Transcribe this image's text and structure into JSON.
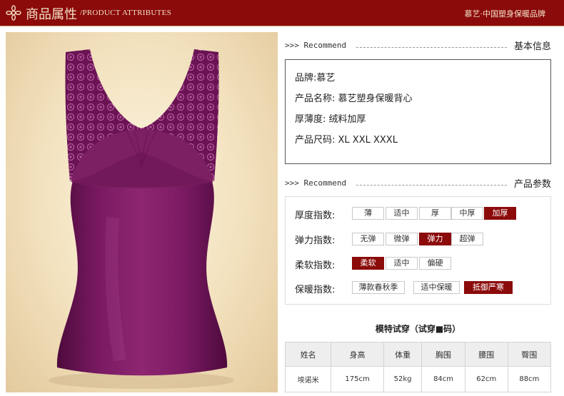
{
  "header": {
    "title_cn": "商品属性",
    "title_en": "/PRODUCT ATTRIBUTES",
    "brand": "慕艺·中国塑身保暖品牌",
    "bg_color": "#8b0a0a"
  },
  "product_image": {
    "alt": "紫色蕾丝保暖背心",
    "color": "#7d1f63"
  },
  "basic_info": {
    "recommend": ">>> Recommend",
    "title": "基本信息",
    "rows": [
      "品牌:慕艺",
      "产品名称: 慕艺塑身保暖背心",
      "厚薄度: 绒料加厚",
      "产品尺码: XL XXL XXXL"
    ]
  },
  "params": {
    "recommend": ">>> Recommend",
    "title": "产品参数",
    "rows": [
      {
        "label": "厚度指数:",
        "options": [
          "薄",
          "适中",
          "厚",
          "中厚",
          "加厚"
        ],
        "selected": 4
      },
      {
        "label": "弹力指数:",
        "options": [
          "无弹",
          "微弹",
          "弹力",
          "超弹"
        ],
        "selected": 2
      },
      {
        "label": "柔软指数:",
        "options": [
          "柔软",
          "适中",
          "偏硬"
        ],
        "selected": 0
      },
      {
        "label": "保暖指数:",
        "options": [
          "薄款春秋季",
          "适中保暖",
          "抵御严寒"
        ],
        "selected": 2
      }
    ],
    "accent": "#8b0a0a"
  },
  "model": {
    "title": "模特试穿（试穿■码）",
    "headers": [
      "姓名",
      "身高",
      "体重",
      "胸围",
      "腰围",
      "臀围"
    ],
    "row": [
      "埃诺米",
      "175cm",
      "52kg",
      "84cm",
      "62cm",
      "88cm"
    ]
  }
}
